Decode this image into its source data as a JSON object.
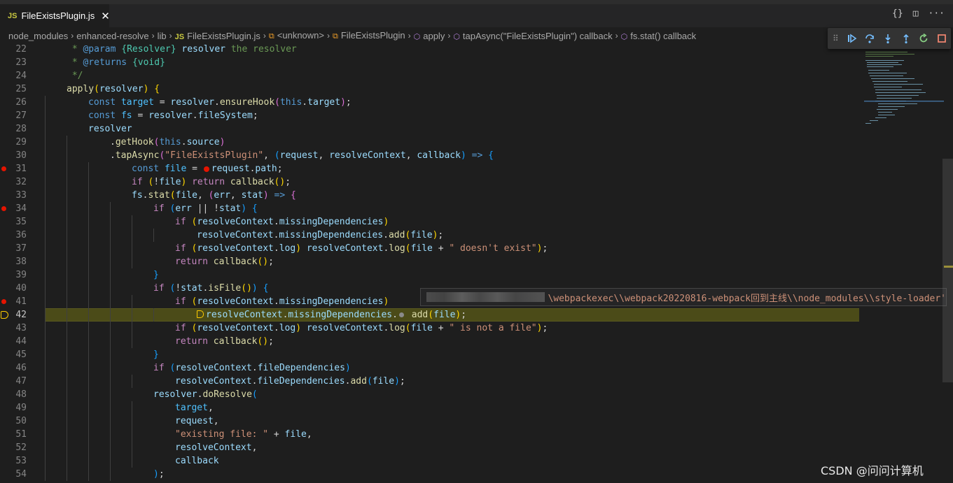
{
  "tab": {
    "icon_label": "JS",
    "title": "FileExistsPlugin.js",
    "close_glyph": "✕"
  },
  "tab_actions": {
    "braces": "{}",
    "split": "◫",
    "more": "···"
  },
  "breadcrumb": [
    {
      "label": "node_modules",
      "icon": ""
    },
    {
      "label": "enhanced-resolve",
      "icon": ""
    },
    {
      "label": "lib",
      "icon": ""
    },
    {
      "label": "FileExistsPlugin.js",
      "icon": "js"
    },
    {
      "label": "<unknown>",
      "icon": "symbol-icon"
    },
    {
      "label": "FileExistsPlugin",
      "icon": "symbol-icon"
    },
    {
      "label": "apply",
      "icon": "cube-icon"
    },
    {
      "label": "tapAsync(\"FileExistsPlugin\") callback",
      "icon": "cube-icon"
    },
    {
      "label": "fs.stat() callback",
      "icon": "cube-icon"
    }
  ],
  "debug_toolbar": [
    "continue-icon",
    "step-over-icon",
    "step-into-icon",
    "step-out-icon",
    "restart-icon",
    "stop-icon"
  ],
  "colors": {
    "breakpoint": "#e51400",
    "current_line": "#4b4b18",
    "tooltip_text": "#ce9178"
  },
  "code_lines": [
    {
      "n": 22,
      "indent": 1,
      "tokens": [
        [
          "c-com",
          " * "
        ],
        [
          "c-tag",
          "@param"
        ],
        [
          "c-com",
          " "
        ],
        [
          "c-type",
          "{Resolver}"
        ],
        [
          "c-var",
          " resolver"
        ],
        [
          "c-com",
          " the resolver"
        ]
      ]
    },
    {
      "n": 23,
      "indent": 1,
      "tokens": [
        [
          "c-com",
          " * "
        ],
        [
          "c-tag",
          "@returns"
        ],
        [
          "c-com",
          " "
        ],
        [
          "c-type",
          "{void}"
        ]
      ]
    },
    {
      "n": 24,
      "indent": 1,
      "tokens": [
        [
          "c-com",
          " */"
        ]
      ]
    },
    {
      "n": 25,
      "indent": 1,
      "tokens": [
        [
          "c-fn",
          "apply"
        ],
        [
          "c-p1",
          "("
        ],
        [
          "c-var",
          "resolver"
        ],
        [
          "c-p1",
          ")"
        ],
        [
          "c-plain",
          " "
        ],
        [
          "c-p1",
          "{"
        ]
      ]
    },
    {
      "n": 26,
      "indent": 2,
      "tokens": [
        [
          "c-kw",
          "const"
        ],
        [
          "c-plain",
          " "
        ],
        [
          "c-const",
          "target"
        ],
        [
          "c-plain",
          " = "
        ],
        [
          "c-var",
          "resolver"
        ],
        [
          "c-plain",
          "."
        ],
        [
          "c-fn",
          "ensureHook"
        ],
        [
          "c-p2",
          "("
        ],
        [
          "c-kw",
          "this"
        ],
        [
          "c-plain",
          "."
        ],
        [
          "c-var",
          "target"
        ],
        [
          "c-p2",
          ")"
        ],
        [
          "c-plain",
          ";"
        ]
      ]
    },
    {
      "n": 27,
      "indent": 2,
      "tokens": [
        [
          "c-kw",
          "const"
        ],
        [
          "c-plain",
          " "
        ],
        [
          "c-const",
          "fs"
        ],
        [
          "c-plain",
          " = "
        ],
        [
          "c-var",
          "resolver"
        ],
        [
          "c-plain",
          "."
        ],
        [
          "c-var",
          "fileSystem"
        ],
        [
          "c-plain",
          ";"
        ]
      ]
    },
    {
      "n": 28,
      "indent": 2,
      "tokens": [
        [
          "c-var",
          "resolver"
        ]
      ]
    },
    {
      "n": 29,
      "indent": 3,
      "tokens": [
        [
          "c-plain",
          "."
        ],
        [
          "c-fn",
          "getHook"
        ],
        [
          "c-p2",
          "("
        ],
        [
          "c-kw",
          "this"
        ],
        [
          "c-plain",
          "."
        ],
        [
          "c-var",
          "source"
        ],
        [
          "c-p2",
          ")"
        ]
      ]
    },
    {
      "n": 30,
      "indent": 3,
      "tokens": [
        [
          "c-plain",
          "."
        ],
        [
          "c-fn",
          "tapAsync"
        ],
        [
          "c-p2",
          "("
        ],
        [
          "c-str",
          "\"FileExistsPlugin\""
        ],
        [
          "c-plain",
          ", "
        ],
        [
          "c-p3",
          "("
        ],
        [
          "c-var",
          "request"
        ],
        [
          "c-plain",
          ", "
        ],
        [
          "c-var",
          "resolveContext"
        ],
        [
          "c-plain",
          ", "
        ],
        [
          "c-var",
          "callback"
        ],
        [
          "c-p3",
          ")"
        ],
        [
          "c-plain",
          " "
        ],
        [
          "c-kw",
          "=>"
        ],
        [
          "c-plain",
          " "
        ],
        [
          "c-p3",
          "{"
        ]
      ]
    },
    {
      "n": 31,
      "indent": 4,
      "bp": true,
      "tokens": [
        [
          "c-kw",
          "const"
        ],
        [
          "c-plain",
          " "
        ],
        [
          "c-const",
          "file"
        ],
        [
          "c-plain",
          " = "
        ],
        [
          "bp",
          ""
        ],
        [
          "c-var",
          "request"
        ],
        [
          "c-plain",
          "."
        ],
        [
          "c-var",
          "path"
        ],
        [
          "c-plain",
          ";"
        ]
      ]
    },
    {
      "n": 32,
      "indent": 4,
      "tokens": [
        [
          "c-ctl",
          "if"
        ],
        [
          "c-plain",
          " "
        ],
        [
          "c-p1",
          "("
        ],
        [
          "c-plain",
          "!"
        ],
        [
          "c-var",
          "file"
        ],
        [
          "c-p1",
          ")"
        ],
        [
          "c-plain",
          " "
        ],
        [
          "c-ctl",
          "return"
        ],
        [
          "c-plain",
          " "
        ],
        [
          "c-fn",
          "callback"
        ],
        [
          "c-p1",
          "()"
        ],
        [
          "c-plain",
          ";"
        ]
      ]
    },
    {
      "n": 33,
      "indent": 4,
      "tokens": [
        [
          "c-var",
          "fs"
        ],
        [
          "c-plain",
          "."
        ],
        [
          "c-fn",
          "stat"
        ],
        [
          "c-p1",
          "("
        ],
        [
          "c-var",
          "file"
        ],
        [
          "c-plain",
          ", "
        ],
        [
          "c-p2",
          "("
        ],
        [
          "c-var",
          "err"
        ],
        [
          "c-plain",
          ", "
        ],
        [
          "c-var",
          "stat"
        ],
        [
          "c-p2",
          ")"
        ],
        [
          "c-plain",
          " "
        ],
        [
          "c-kw",
          "=>"
        ],
        [
          "c-plain",
          " "
        ],
        [
          "c-p2",
          "{"
        ]
      ]
    },
    {
      "n": 34,
      "indent": 5,
      "bp": true,
      "tokens": [
        [
          "c-ctl",
          "if"
        ],
        [
          "c-plain",
          " "
        ],
        [
          "c-p3",
          "("
        ],
        [
          "c-var",
          "err"
        ],
        [
          "c-plain",
          " || !"
        ],
        [
          "c-var",
          "stat"
        ],
        [
          "c-p3",
          ")"
        ],
        [
          "c-plain",
          " "
        ],
        [
          "c-p3",
          "{"
        ]
      ]
    },
    {
      "n": 35,
      "indent": 6,
      "tokens": [
        [
          "c-ctl",
          "if"
        ],
        [
          "c-plain",
          " "
        ],
        [
          "c-p1",
          "("
        ],
        [
          "c-var",
          "resolveContext"
        ],
        [
          "c-plain",
          "."
        ],
        [
          "c-var",
          "missingDependencies"
        ],
        [
          "c-p1",
          ")"
        ]
      ]
    },
    {
      "n": 36,
      "indent": 7,
      "tokens": [
        [
          "c-var",
          "resolveContext"
        ],
        [
          "c-plain",
          "."
        ],
        [
          "c-var",
          "missingDependencies"
        ],
        [
          "c-plain",
          "."
        ],
        [
          "c-fn",
          "add"
        ],
        [
          "c-p1",
          "("
        ],
        [
          "c-var",
          "file"
        ],
        [
          "c-p1",
          ")"
        ],
        [
          "c-plain",
          ";"
        ]
      ]
    },
    {
      "n": 37,
      "indent": 6,
      "tokens": [
        [
          "c-ctl",
          "if"
        ],
        [
          "c-plain",
          " "
        ],
        [
          "c-p1",
          "("
        ],
        [
          "c-var",
          "resolveContext"
        ],
        [
          "c-plain",
          "."
        ],
        [
          "c-var",
          "log"
        ],
        [
          "c-p1",
          ")"
        ],
        [
          "c-plain",
          " "
        ],
        [
          "c-var",
          "resolveContext"
        ],
        [
          "c-plain",
          "."
        ],
        [
          "c-fn",
          "log"
        ],
        [
          "c-p1",
          "("
        ],
        [
          "c-var",
          "file"
        ],
        [
          "c-plain",
          " + "
        ],
        [
          "c-str",
          "\" doesn't exist\""
        ],
        [
          "c-p1",
          ")"
        ],
        [
          "c-plain",
          ";"
        ]
      ]
    },
    {
      "n": 38,
      "indent": 6,
      "tokens": [
        [
          "c-ctl",
          "return"
        ],
        [
          "c-plain",
          " "
        ],
        [
          "c-fn",
          "callback"
        ],
        [
          "c-p1",
          "()"
        ],
        [
          "c-plain",
          ";"
        ]
      ]
    },
    {
      "n": 39,
      "indent": 5,
      "tokens": [
        [
          "c-p3",
          "}"
        ]
      ]
    },
    {
      "n": 40,
      "indent": 5,
      "tokens": [
        [
          "c-ctl",
          "if"
        ],
        [
          "c-plain",
          " "
        ],
        [
          "c-p3",
          "("
        ],
        [
          "c-plain",
          "!"
        ],
        [
          "c-var",
          "stat"
        ],
        [
          "c-plain",
          "."
        ],
        [
          "c-fn",
          "isFile"
        ],
        [
          "c-p1",
          "()"
        ],
        [
          "c-p3",
          ")"
        ],
        [
          "c-plain",
          " "
        ],
        [
          "c-p3",
          "{"
        ]
      ]
    },
    {
      "n": 41,
      "indent": 6,
      "bp": true,
      "tokens": [
        [
          "c-ctl",
          "if"
        ],
        [
          "c-plain",
          " "
        ],
        [
          "c-p1",
          "("
        ],
        [
          "c-var",
          "resolveContext"
        ],
        [
          "c-plain",
          "."
        ],
        [
          "c-var",
          "missingDependencies"
        ],
        [
          "c-p1",
          ")"
        ]
      ]
    },
    {
      "n": 42,
      "indent": 7,
      "current": true,
      "tokens": [
        [
          "cur",
          ""
        ],
        [
          "c-var",
          "resolveContext"
        ],
        [
          "c-plain",
          "."
        ],
        [
          "c-var",
          "missingDependencies"
        ],
        [
          "c-plain",
          "."
        ],
        [
          "dot",
          ""
        ],
        [
          "c-plain",
          " "
        ],
        [
          "c-fn",
          "add"
        ],
        [
          "c-p1",
          "("
        ],
        [
          "c-var",
          "file"
        ],
        [
          "c-p1",
          ")"
        ],
        [
          "c-plain",
          ";"
        ]
      ]
    },
    {
      "n": 43,
      "indent": 6,
      "tokens": [
        [
          "c-ctl",
          "if"
        ],
        [
          "c-plain",
          " "
        ],
        [
          "c-p1",
          "("
        ],
        [
          "c-var",
          "resolveContext"
        ],
        [
          "c-plain",
          "."
        ],
        [
          "c-var",
          "log"
        ],
        [
          "c-p1",
          ")"
        ],
        [
          "c-plain",
          " "
        ],
        [
          "c-var",
          "resolveContext"
        ],
        [
          "c-plain",
          "."
        ],
        [
          "c-fn",
          "log"
        ],
        [
          "c-p1",
          "("
        ],
        [
          "c-var",
          "file"
        ],
        [
          "c-plain",
          " + "
        ],
        [
          "c-str",
          "\" is not a file\""
        ],
        [
          "c-p1",
          ")"
        ],
        [
          "c-plain",
          ";"
        ]
      ]
    },
    {
      "n": 44,
      "indent": 6,
      "tokens": [
        [
          "c-ctl",
          "return"
        ],
        [
          "c-plain",
          " "
        ],
        [
          "c-fn",
          "callback"
        ],
        [
          "c-p1",
          "()"
        ],
        [
          "c-plain",
          ";"
        ]
      ]
    },
    {
      "n": 45,
      "indent": 5,
      "tokens": [
        [
          "c-p3",
          "}"
        ]
      ]
    },
    {
      "n": 46,
      "indent": 5,
      "tokens": [
        [
          "c-ctl",
          "if"
        ],
        [
          "c-plain",
          " "
        ],
        [
          "c-p3",
          "("
        ],
        [
          "c-var",
          "resolveContext"
        ],
        [
          "c-plain",
          "."
        ],
        [
          "c-var",
          "fileDependencies"
        ],
        [
          "c-p3",
          ")"
        ]
      ]
    },
    {
      "n": 47,
      "indent": 6,
      "tokens": [
        [
          "c-var",
          "resolveContext"
        ],
        [
          "c-plain",
          "."
        ],
        [
          "c-var",
          "fileDependencies"
        ],
        [
          "c-plain",
          "."
        ],
        [
          "c-fn",
          "add"
        ],
        [
          "c-p3",
          "("
        ],
        [
          "c-var",
          "file"
        ],
        [
          "c-p3",
          ")"
        ],
        [
          "c-plain",
          ";"
        ]
      ]
    },
    {
      "n": 48,
      "indent": 5,
      "tokens": [
        [
          "c-var",
          "resolver"
        ],
        [
          "c-plain",
          "."
        ],
        [
          "c-fn",
          "doResolve"
        ],
        [
          "c-p3",
          "("
        ]
      ]
    },
    {
      "n": 49,
      "indent": 6,
      "tokens": [
        [
          "c-const",
          "target"
        ],
        [
          "c-plain",
          ","
        ]
      ]
    },
    {
      "n": 50,
      "indent": 6,
      "tokens": [
        [
          "c-var",
          "request"
        ],
        [
          "c-plain",
          ","
        ]
      ]
    },
    {
      "n": 51,
      "indent": 6,
      "tokens": [
        [
          "c-str",
          "\"existing file: \""
        ],
        [
          "c-plain",
          " + "
        ],
        [
          "c-var",
          "file"
        ],
        [
          "c-plain",
          ","
        ]
      ]
    },
    {
      "n": 52,
      "indent": 6,
      "tokens": [
        [
          "c-var",
          "resolveContext"
        ],
        [
          "c-plain",
          ","
        ]
      ]
    },
    {
      "n": 53,
      "indent": 6,
      "tokens": [
        [
          "c-var",
          "callback"
        ]
      ]
    },
    {
      "n": 54,
      "indent": 5,
      "tokens": [
        [
          "c-p3",
          ")"
        ],
        [
          "c-plain",
          ";"
        ]
      ]
    }
  ],
  "hover_tooltip": {
    "text": "\\webpackexec\\\\webpack20220816-webpack回到主线\\\\node_modules\\\\style-loader'"
  },
  "watermark": "CSDN @问问计算机"
}
